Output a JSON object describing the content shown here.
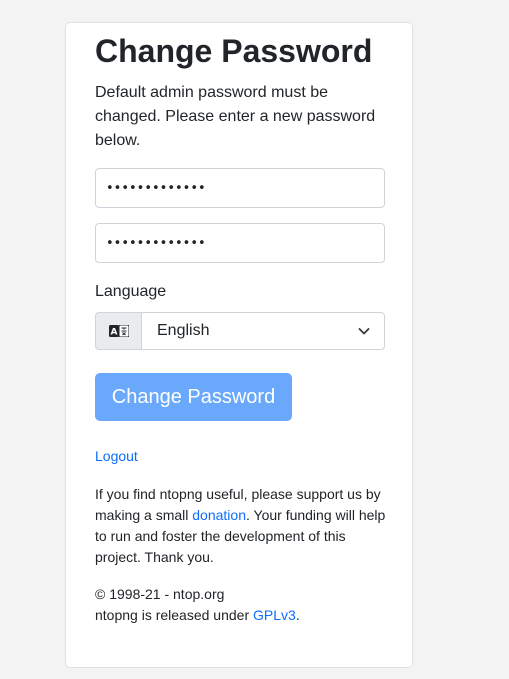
{
  "title": "Change Password",
  "intro": "Default admin password must be changed. Please enter a new password below.",
  "fields": {
    "new_password_value": "•••••••••••••",
    "confirm_password_value": "•••••••••••••"
  },
  "language": {
    "label": "Language",
    "addon_icon": "language-icon",
    "selected": "English"
  },
  "submit_label": "Change Password",
  "logout_label": "Logout",
  "support": {
    "text_before": "If you find ntopng useful, please support us by making a small ",
    "donation_link": "donation",
    "text_after": ". Your funding will help to run and foster the development of this project. Thank you."
  },
  "footer": {
    "copyright": "© 1998-21 - ntop.org",
    "license_before": "ntopng is released under ",
    "license_link": "GPLv3",
    "license_after": "."
  },
  "colors": {
    "background": "#f3f3f4",
    "button": "#6aa8fb",
    "link": "#0d6efd"
  }
}
